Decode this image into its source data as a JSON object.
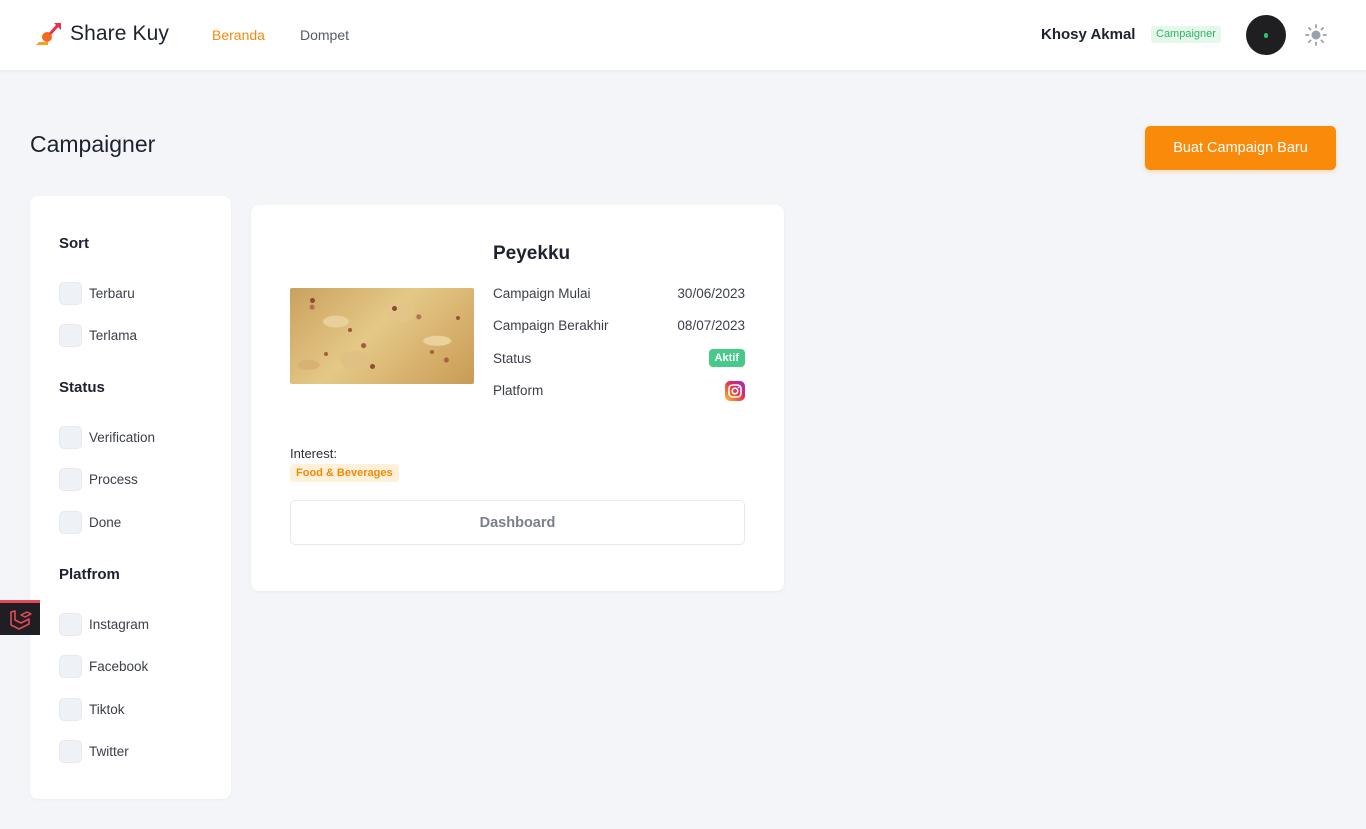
{
  "app": {
    "brand": "Share Kuy",
    "nav": {
      "home": "Beranda",
      "wallet": "Dompet"
    },
    "user": {
      "name": "Khosy Akmal",
      "role": "Campaigner"
    }
  },
  "page": {
    "title": "Campaigner",
    "new_campaign_label": "Buat Campaign Baru"
  },
  "filters": {
    "sort": {
      "heading": "Sort",
      "options": [
        "Terbaru",
        "Terlama"
      ]
    },
    "status": {
      "heading": "Status",
      "options": [
        "Verification",
        "Process",
        "Done"
      ]
    },
    "platform": {
      "heading": "Platfrom",
      "options": [
        "Instagram",
        "Facebook",
        "Tiktok",
        "Twitter"
      ]
    }
  },
  "campaign": {
    "title": "Peyekku",
    "start_label": "Campaign Mulai",
    "start_value": "30/06/2023",
    "end_label": "Campaign Berakhir",
    "end_value": "08/07/2023",
    "status_label": "Status",
    "status_value": "Aktif",
    "platform_label": "Platform",
    "platform_icon": "instagram-icon",
    "interest_label": "Interest:",
    "interest_tag": "Food & Beverages",
    "dashboard_label": "Dashboard"
  },
  "colors": {
    "accent": "#f98a0a",
    "status_active": "#47c98a",
    "role_badge": "#2fb563"
  }
}
